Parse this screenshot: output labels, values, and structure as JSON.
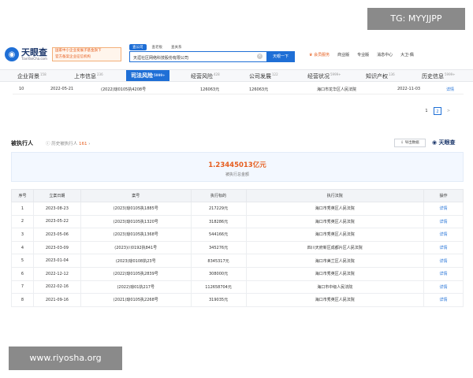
{
  "watermarks": {
    "tg": "TG: MYYJJPP",
    "site": "www.riyosha.org"
  },
  "logo": {
    "name": "天眼查",
    "url": "TianYanCha.com"
  },
  "banner": {
    "line1": "国家中小企业发展子基金旗下",
    "line2": "官方备案企业征信机构"
  },
  "search": {
    "tabs": [
      "查公司",
      "查老板",
      "查关系"
    ],
    "value": "天涯社区网络科技股份有限公司",
    "button": "天眼一下"
  },
  "topnav": {
    "vip": "会员服务",
    "items": [
      "商业版",
      "专业版",
      "消息中心",
      "大卫·偶"
    ]
  },
  "modules": [
    {
      "label": "企业背景",
      "count": "158"
    },
    {
      "label": "上市信息",
      "count": "236"
    },
    {
      "label": "司法风险",
      "count": "5999+"
    },
    {
      "label": "经营风险",
      "count": "428"
    },
    {
      "label": "公司发展",
      "count": "122"
    },
    {
      "label": "经营状况",
      "count": "5999+"
    },
    {
      "label": "知识产权",
      "count": "136"
    },
    {
      "label": "历史信息",
      "count": "5999+"
    }
  ],
  "prev_row": {
    "no": "10",
    "date": "2022-05-21",
    "case": "(2022)琼0105执4208号",
    "amount1": "126063元",
    "amount2": "126063元",
    "court": "海口市龙华区人民法院",
    "date2": "2022-11-03",
    "action": "详情"
  },
  "pager": {
    "pages": [
      "1",
      "2"
    ],
    "current": "2",
    "next": ">"
  },
  "section": {
    "title": "被执行人",
    "history_label": "历史被执行人",
    "history_count": "161",
    "export": "导出数据",
    "brand": "天眼查"
  },
  "summary": {
    "value": "1.23445013亿元",
    "label": "被执行总金额"
  },
  "table": {
    "headers": [
      "序号",
      "立案日期",
      "案号",
      "执行标的",
      "执行法院",
      "操作"
    ],
    "rows": [
      [
        "1",
        "2023-08-23",
        "(2023)琼0105执1885号",
        "217229元",
        "海口市秀英区人民法院",
        "详情"
      ],
      [
        "2",
        "2023-05-22",
        "(2023)琼0105执1320号",
        "318286元",
        "海口市秀英区人民法院",
        "详情"
      ],
      [
        "3",
        "2023-05-06",
        "(2023)琼0105执1368号",
        "544166元",
        "海口市秀英区人民法院",
        "详情"
      ],
      [
        "4",
        "2023-03-09",
        "(2023)川0192执841号",
        "345276元",
        "四川天府新区成都片区人民法院",
        "详情"
      ],
      [
        "5",
        "2023-01-04",
        "(2023)琼0108执23号",
        "8345317元",
        "海口市美兰区人民法院",
        "详情"
      ],
      [
        "6",
        "2022-12-12",
        "(2022)琼0105执2839号",
        "308000元",
        "海口市秀英区人民法院",
        "详情"
      ],
      [
        "7",
        "2022-02-16",
        "(2022)琼01执217号",
        "112658704元",
        "海口市中级人民法院",
        "详情"
      ],
      [
        "8",
        "2021-09-16",
        "(2021)琼0105执2268号",
        "319035元",
        "海口市秀英区人民法院",
        "详情"
      ]
    ]
  },
  "colors": {
    "accent": "#1f6fd6",
    "warning": "#e65d1d"
  }
}
